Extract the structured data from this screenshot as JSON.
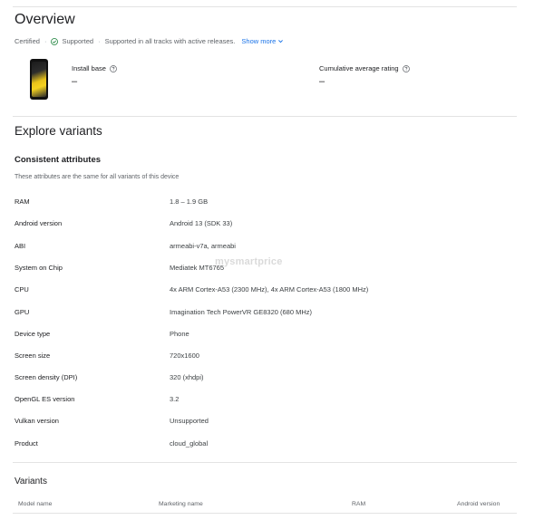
{
  "overview": {
    "title": "Overview",
    "certified_label": "Certified",
    "supported_label": "Supported",
    "supported_desc": "Supported in all tracks with active releases.",
    "show_more_label": "Show more",
    "install_base": {
      "label": "Install base",
      "value": "–"
    },
    "avg_rating": {
      "label": "Cumulative average rating",
      "value": "–"
    }
  },
  "explore": {
    "title": "Explore variants",
    "consistent_title": "Consistent attributes",
    "consistent_subtitle": "These attributes are the same for all variants of this device",
    "attributes": [
      {
        "name": "RAM",
        "value": "1.8 – 1.9 GB"
      },
      {
        "name": "Android version",
        "value": "Android 13 (SDK 33)"
      },
      {
        "name": "ABI",
        "value": "armeabi-v7a, armeabi"
      },
      {
        "name": "System on Chip",
        "value": "Mediatek MT6765"
      },
      {
        "name": "CPU",
        "value": "4x ARM Cortex-A53 (2300 MHz), 4x ARM Cortex-A53 (1800 MHz)"
      },
      {
        "name": "GPU",
        "value": "Imagination Tech PowerVR GE8320 (680 MHz)"
      },
      {
        "name": "Device type",
        "value": "Phone"
      },
      {
        "name": "Screen size",
        "value": "720x1600"
      },
      {
        "name": "Screen density (DPI)",
        "value": "320 (xhdpi)"
      },
      {
        "name": "OpenGL ES version",
        "value": "3.2"
      },
      {
        "name": "Vulkan version",
        "value": "Unsupported"
      },
      {
        "name": "Product",
        "value": "cloud_global"
      }
    ]
  },
  "watermark": "mysmartprice",
  "variants": {
    "title": "Variants",
    "columns": [
      "Model name",
      "Marketing name",
      "RAM",
      "Android version"
    ]
  },
  "colors": {
    "accent": "#1a73e8",
    "supported_green": "#188038",
    "text_primary": "#202124",
    "text_secondary": "#5f6368"
  }
}
